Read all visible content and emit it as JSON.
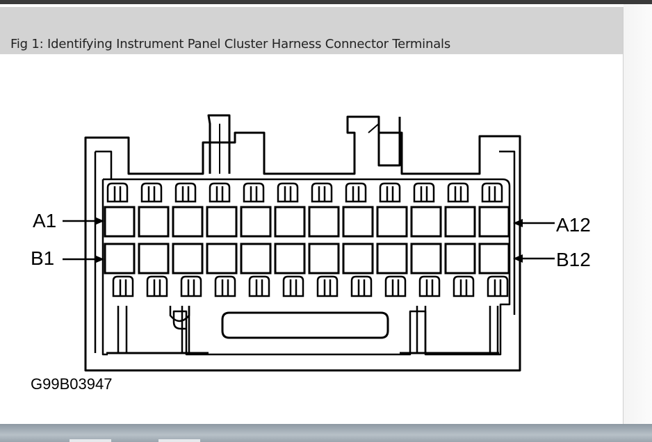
{
  "figure": {
    "caption": "Fig 1: Identifying Instrument Panel Cluster Harness Connector Terminals",
    "image_code": "G99B03947"
  },
  "connector": {
    "labels": {
      "a_first": "A1",
      "a_last": "A12",
      "b_first": "B1",
      "b_last": "B12"
    },
    "terminals_per_row": 12,
    "rows": [
      "A",
      "B"
    ]
  }
}
